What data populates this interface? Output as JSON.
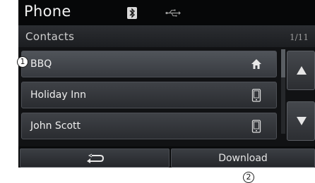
{
  "statusbar": {
    "title": "Phone",
    "icons": [
      "bluetooth-icon",
      "usb-icon"
    ]
  },
  "header": {
    "section": "Contacts",
    "page_indicator": "1/11"
  },
  "contacts": [
    {
      "name": "BBQ",
      "icon": "home-icon",
      "selected": true
    },
    {
      "name": "Holiday Inn",
      "icon": "mobile-phone-icon",
      "selected": false
    },
    {
      "name": "John Scott",
      "icon": "mobile-phone-icon",
      "selected": false
    }
  ],
  "nav": {
    "up_icon": "arrow-up-icon",
    "down_icon": "arrow-down-icon"
  },
  "bottom": {
    "back_icon": "back-arrow-icon",
    "download_label": "Download"
  },
  "callouts": [
    "1",
    "2"
  ]
}
